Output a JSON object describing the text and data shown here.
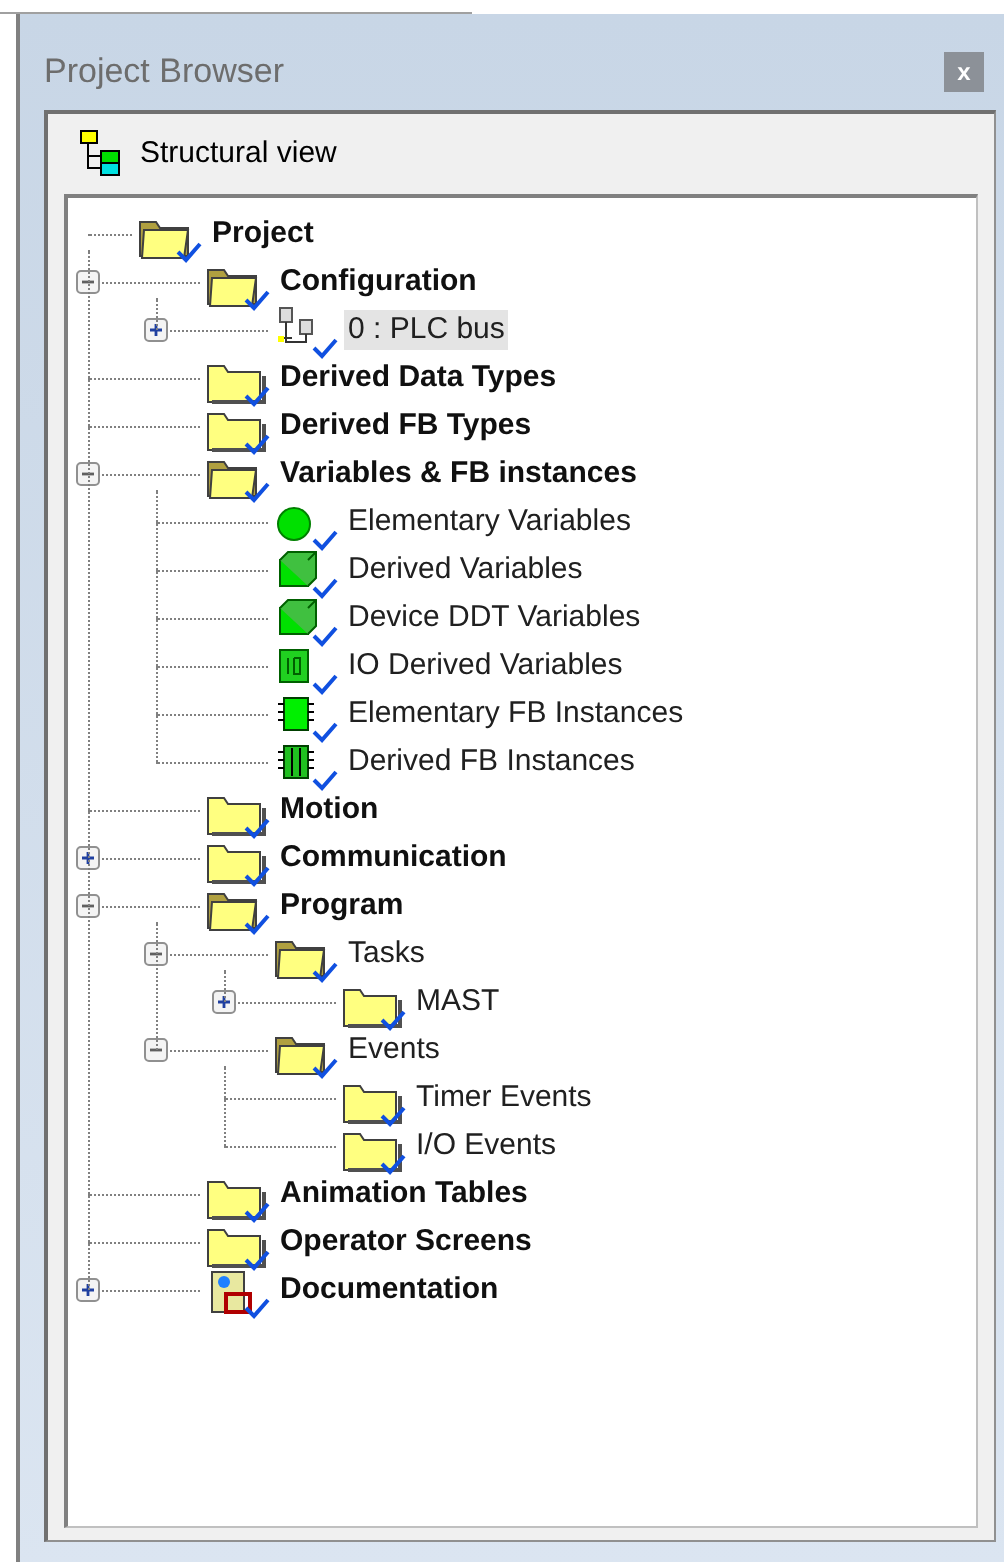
{
  "window": {
    "title": "Project Browser",
    "close_label": "x"
  },
  "view": {
    "label": "Structural view"
  },
  "tree": [
    {
      "label": "Project",
      "kind": "folder_open",
      "selected": false,
      "children": [
        {
          "label": "Configuration",
          "kind": "folder_open",
          "expanded": true,
          "selected": false,
          "children": [
            {
              "label": "0 : PLC bus",
              "kind": "plc_bus",
              "expanded": false,
              "selected": true
            }
          ]
        },
        {
          "label": "Derived Data Types",
          "kind": "folder",
          "selected": false
        },
        {
          "label": "Derived FB Types",
          "kind": "folder",
          "selected": false
        },
        {
          "label": "Variables & FB instances",
          "kind": "folder_open",
          "expanded": true,
          "selected": false,
          "children": [
            {
              "label": "Elementary Variables",
              "kind": "var_elementary",
              "selected": false
            },
            {
              "label": "Derived Variables",
              "kind": "var_derived",
              "selected": false
            },
            {
              "label": "Device DDT Variables",
              "kind": "var_derived",
              "selected": false
            },
            {
              "label": "IO Derived Variables",
              "kind": "var_io",
              "selected": false
            },
            {
              "label": "Elementary FB Instances",
              "kind": "fb_elementary",
              "selected": false
            },
            {
              "label": "Derived FB Instances",
              "kind": "fb_derived",
              "selected": false
            }
          ]
        },
        {
          "label": "Motion",
          "kind": "folder",
          "selected": false
        },
        {
          "label": "Communication",
          "kind": "folder",
          "expanded": false,
          "selected": false
        },
        {
          "label": "Program",
          "kind": "folder_open",
          "expanded": true,
          "selected": false,
          "children": [
            {
              "label": "Tasks",
              "kind": "folder_open",
              "expanded": true,
              "selected": false,
              "children": [
                {
                  "label": "MAST",
                  "kind": "folder",
                  "expanded": false,
                  "selected": false
                }
              ]
            },
            {
              "label": "Events",
              "kind": "folder_open",
              "expanded": true,
              "selected": false,
              "children": [
                {
                  "label": "Timer Events",
                  "kind": "folder",
                  "selected": false
                },
                {
                  "label": "I/O Events",
                  "kind": "folder",
                  "selected": false
                }
              ]
            }
          ]
        },
        {
          "label": "Animation Tables",
          "kind": "folder",
          "selected": false
        },
        {
          "label": "Operator Screens",
          "kind": "folder",
          "selected": false
        },
        {
          "label": "Documentation",
          "kind": "documentation",
          "expanded": false,
          "selected": false
        }
      ]
    }
  ]
}
